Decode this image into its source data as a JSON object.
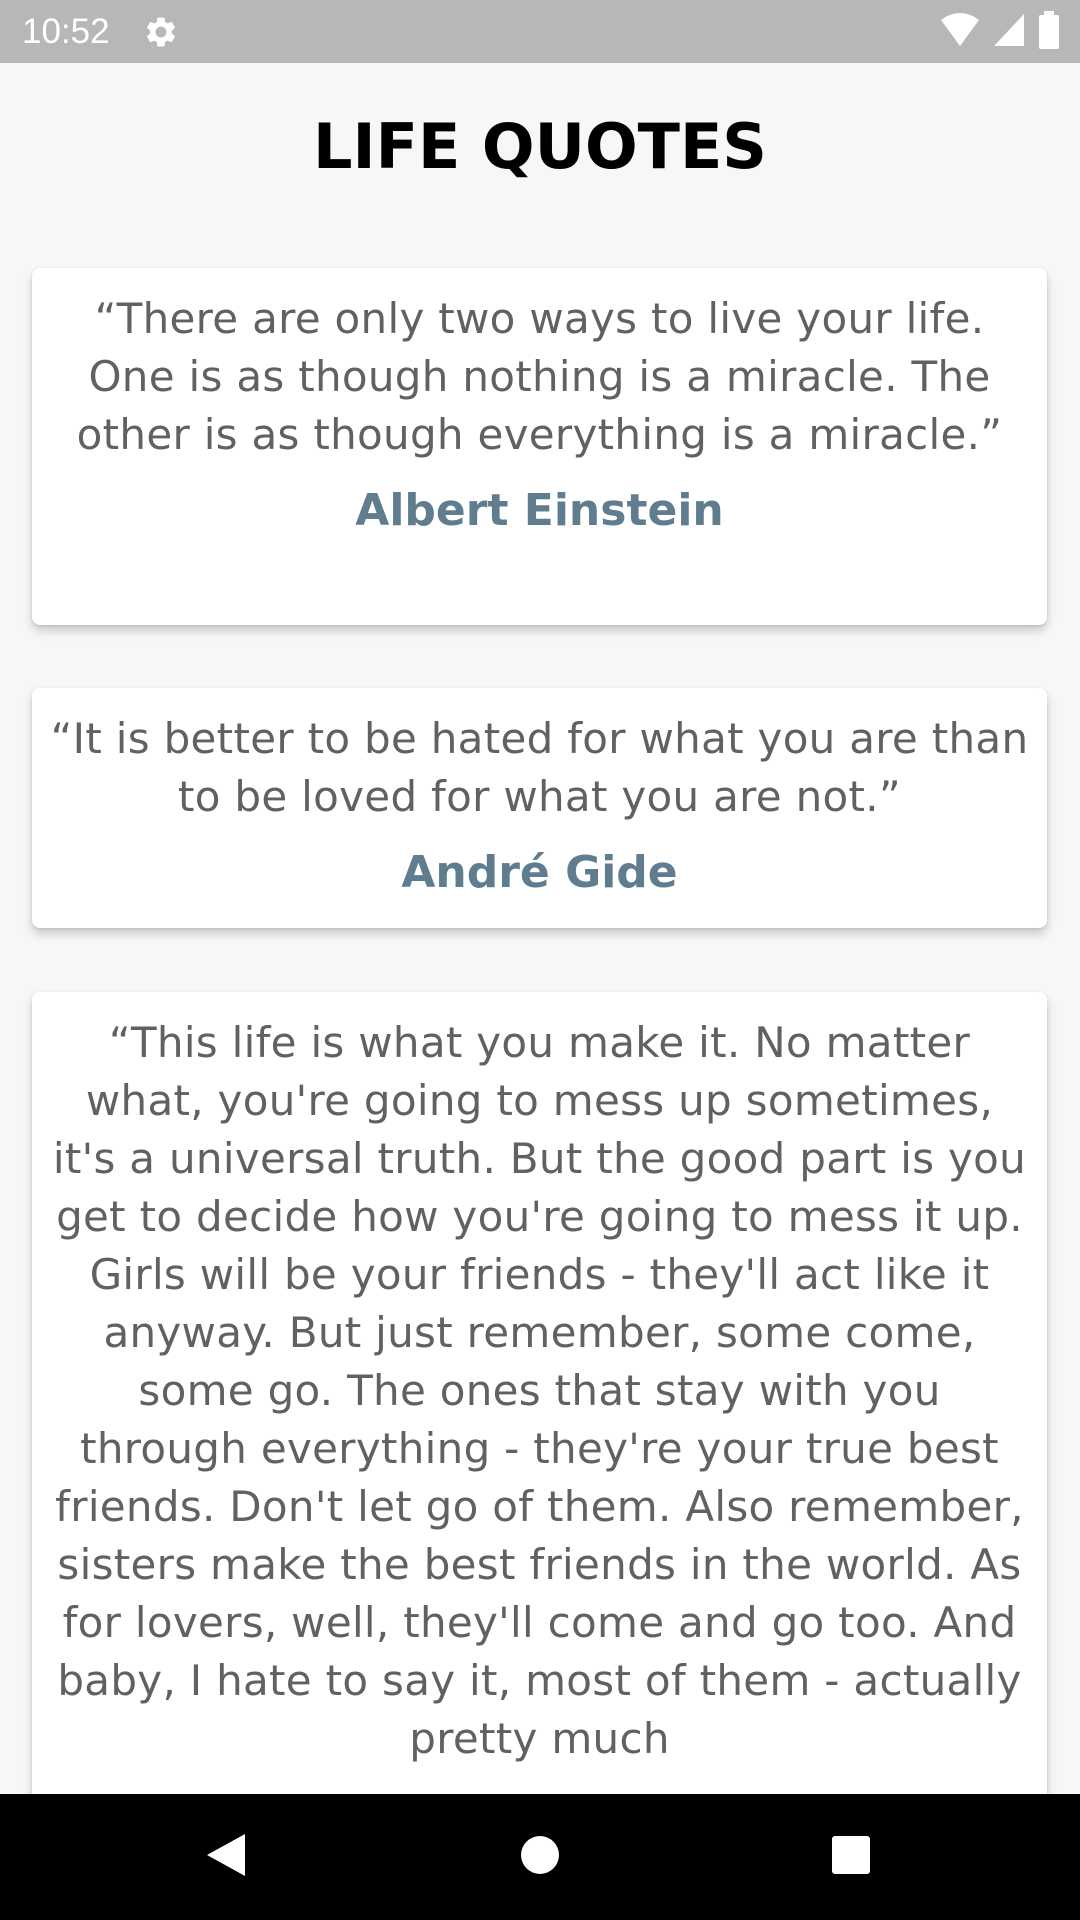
{
  "status_bar": {
    "time": "10:52",
    "icons": [
      "gear-icon",
      "wifi-icon",
      "cell-signal-icon",
      "battery-icon"
    ]
  },
  "screen": {
    "title": "LIFE QUOTES"
  },
  "quotes": [
    {
      "text": "“There are only two ways to live your life. One is as though nothing is a miracle. The other is as though everything is a miracle.”",
      "author": "Albert Einstein"
    },
    {
      "text": "“It is better to be hated for what you are than to be loved for what you are not.”",
      "author": "André Gide"
    },
    {
      "text": "“This life is what you make it. No matter what, you're going to mess up sometimes, it's a universal truth. But the good part is you get to decide how you're going to mess it up. Girls will be your friends - they'll act like it anyway. But just remember, some come, some go. The ones that stay with you through everything - they're your true best friends. Don't let go of them. Also remember, sisters make the best friends in the world. As for lovers, well, they'll come and go too. And baby, I hate to say it, most of them - actually pretty much"
    }
  ],
  "nav_bar": {
    "icons": [
      "back-icon",
      "home-icon",
      "recents-icon"
    ]
  },
  "colors": {
    "status_bar": "#b7b7b7",
    "background": "#f7f7f7",
    "quote_text": "#616161",
    "author_text": "#5f7d8f",
    "nav_bar": "#000000"
  }
}
